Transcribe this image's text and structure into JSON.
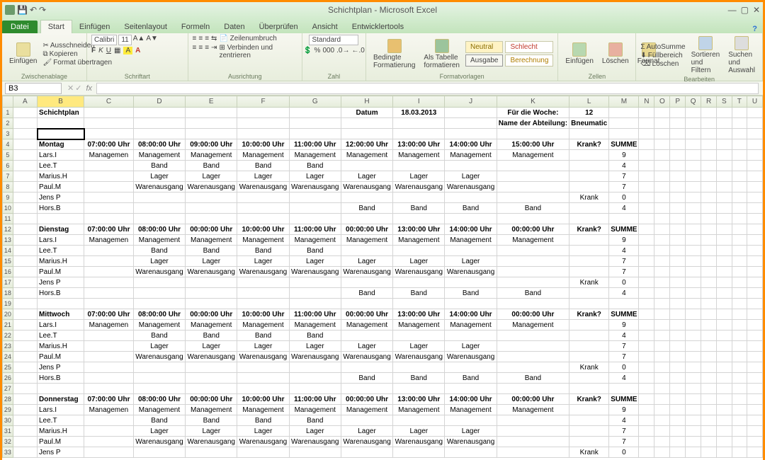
{
  "window": {
    "title": "Schichtplan - Microsoft Excel"
  },
  "tabs": {
    "file": "Datei",
    "items": [
      "Start",
      "Einfügen",
      "Seitenlayout",
      "Formeln",
      "Daten",
      "Überprüfen",
      "Ansicht",
      "Entwicklertools"
    ],
    "active": 0
  },
  "ribbon": {
    "clipboard": {
      "paste": "Einfügen",
      "cut": "Ausschneiden",
      "copy": "Kopieren",
      "painter": "Format übertragen",
      "label": "Zwischenablage"
    },
    "font": {
      "name": "Calibri",
      "size": "11",
      "label": "Schriftart"
    },
    "align": {
      "wrap": "Zeilenumbruch",
      "merge": "Verbinden und zentrieren",
      "label": "Ausrichtung"
    },
    "number": {
      "format": "Standard",
      "label": "Zahl"
    },
    "styles": {
      "cond": "Bedingte Formatierung",
      "table": "Als Tabelle formatieren",
      "neutral": "Neutral",
      "bad": "Schlecht",
      "output": "Ausgabe",
      "calc": "Berechnung",
      "label": "Formatvorlagen"
    },
    "cells": {
      "insert": "Einfügen",
      "delete": "Löschen",
      "format": "Format",
      "label": "Zellen"
    },
    "edit": {
      "sum": "AutoSumme",
      "fill": "Füllbereich",
      "clear": "Löschen",
      "sort": "Sortieren und Filtern",
      "find": "Suchen und Auswahl",
      "label": "Bearbeiten"
    }
  },
  "namebox": "B3",
  "columns": [
    "",
    "A",
    "B",
    "C",
    "D",
    "E",
    "F",
    "G",
    "H",
    "I",
    "J",
    "K",
    "L",
    "M",
    "N",
    "O",
    "P",
    "Q",
    "R",
    "S",
    "T",
    "U"
  ],
  "grid": {
    "r1": {
      "B": "Schichtplan",
      "H": "Datum",
      "I": "18.03.2013",
      "K": "Für die Woche:",
      "L": "12"
    },
    "r2": {
      "K": "Name der Abteilung:",
      "L": "Bneumatic"
    },
    "times1": [
      "07:00:00 Uhr",
      "08:00:00 Uhr",
      "09:00:00 Uhr",
      "10:00:00 Uhr",
      "11:00:00 Uhr",
      "12:00:00 Uhr",
      "13:00:00 Uhr",
      "14:00:00 Uhr",
      "15:00:00 Uhr"
    ],
    "times2": [
      "07:00:00 Uhr",
      "08:00:00 Uhr",
      "00:00:00 Uhr",
      "10:00:00 Uhr",
      "11:00:00 Uhr",
      "00:00:00 Uhr",
      "13:00:00 Uhr",
      "14:00:00 Uhr",
      "00:00:00 Uhr"
    ],
    "krank": "Krank?",
    "summe": "SUMME",
    "krankval": "Krank",
    "days": [
      "Montag",
      "Dienstag",
      "Mittwoch",
      "Donnerstag"
    ],
    "names": [
      "Lars.I",
      "Lee.T",
      "Marius.H",
      "Paul.M",
      "Jens P",
      "Hors.B"
    ],
    "mgmt": "Management",
    "mgmtS": "Managemen",
    "band": "Band",
    "lager": "Lager",
    "waren": "Warenausgang",
    "sum": {
      "lars": "9",
      "lee": "4",
      "marius": "7",
      "paul": "7",
      "jens": "0",
      "hors": "4"
    }
  }
}
